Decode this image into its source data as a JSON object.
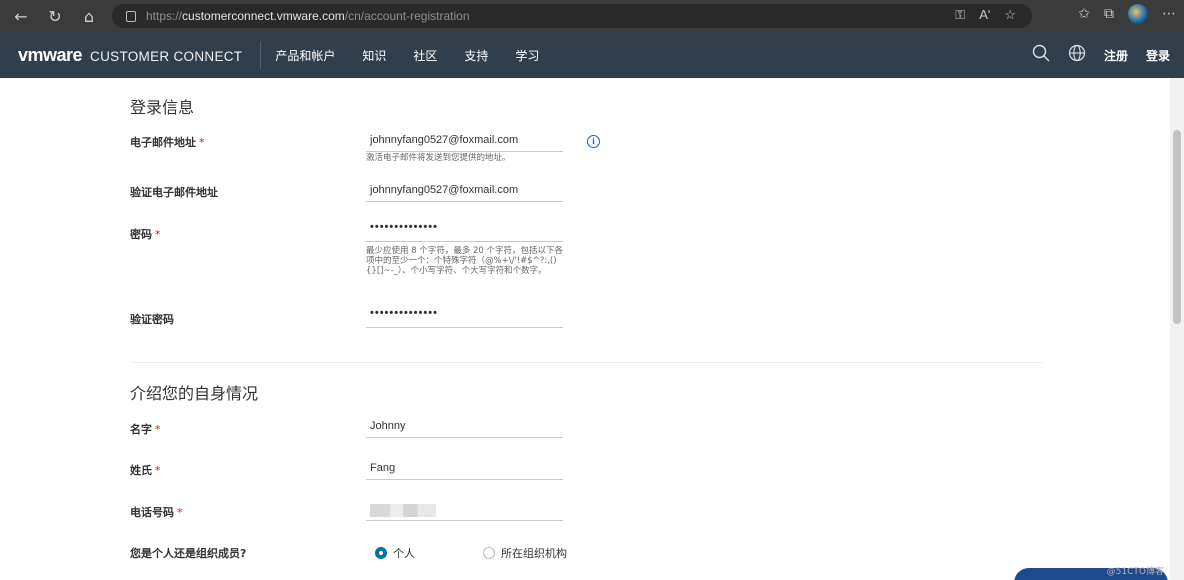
{
  "browser": {
    "url_scheme": "https://",
    "url_host": "customerconnect.vmware.com",
    "url_path": "/cn/account-registration",
    "read_aloud": "Aʹ"
  },
  "header": {
    "logo_brand": "vmware",
    "logo_product": "CUSTOMER CONNECT",
    "nav": [
      "产品和帐户",
      "知识",
      "社区",
      "支持",
      "学习"
    ],
    "register": "注册",
    "login": "登录"
  },
  "login_section": {
    "title": "登录信息",
    "email_label": "电子邮件地址",
    "email_value": "johnnyfang0527@foxmail.com",
    "email_help": "激活电子邮件将发送到您提供的地址。",
    "verify_email_label": "验证电子邮件地址",
    "verify_email_value": "johnnyfang0527@foxmail.com",
    "password_label": "密码",
    "password_value": "••••••••••••••",
    "password_help": "最少应使用 8 个字符，最多 20 个字符，包括以下各项中的至少一个：个特殊字符（@%+\\/'!#$^?:,(){}[]~-_）、个小写字符、个大写字符和个数字。",
    "verify_password_label": "验证密码",
    "verify_password_value": "••••••••••••••",
    "required_mark": "*"
  },
  "profile_section": {
    "title": "介绍您的自身情况",
    "first_name_label": "名字",
    "first_name_value": "Johnny",
    "last_name_label": "姓氏",
    "last_name_value": "Fang",
    "phone_label": "电话号码",
    "member_label": "您是个人还是组织成员?",
    "option_individual": "个人",
    "option_org": "所在组织机构"
  },
  "watermark": "@51CTO博客",
  "colors": {
    "header_bg": "#313e4b",
    "browser_bg": "#3b3b3b",
    "radio_accent": "#0072a3",
    "required": "#c92100"
  }
}
